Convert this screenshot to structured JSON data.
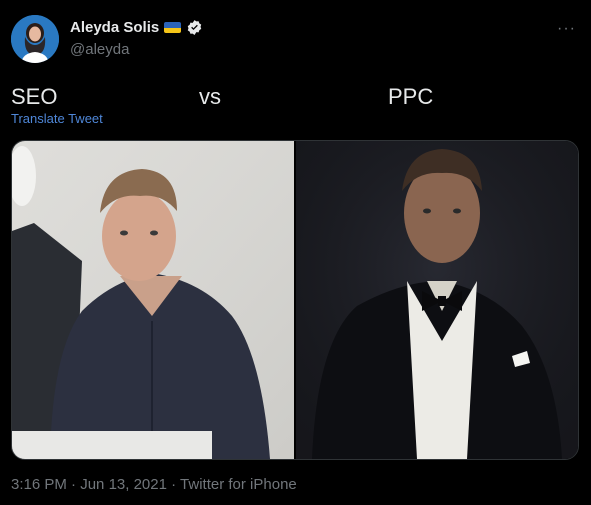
{
  "author": {
    "display_name": "Aleyda Solis",
    "handle": "@aleyda",
    "flag_colors": [
      "#2b63b8",
      "#f5c518"
    ],
    "verified_color": "#e7e9ea",
    "verified_icon": "verified-badge-icon"
  },
  "menu": {
    "more_label": "···"
  },
  "tweet": {
    "text_left": "SEO",
    "text_middle": "vs",
    "text_right": "PPC",
    "translate_label": "Translate Tweet"
  },
  "meta": {
    "time": "3:16 PM",
    "date": "Jun 13, 2021",
    "source": "Twitter for iPhone",
    "separator": " · "
  },
  "colors": {
    "background": "#000000",
    "text_primary": "#e7e9ea",
    "text_secondary": "#71767b",
    "link": "#4f87d8"
  }
}
